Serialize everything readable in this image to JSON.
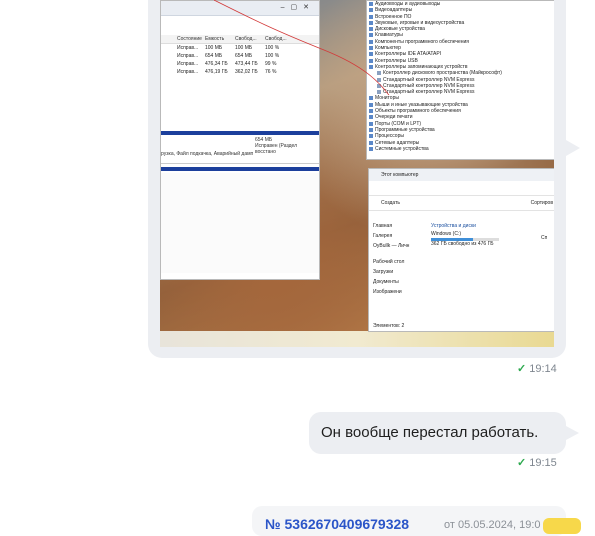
{
  "messages": [
    {
      "type": "image",
      "time": "19:14",
      "screenshot": {
        "disk_management": {
          "columns": [
            "",
            "Состояние",
            "Емкость",
            "Свобод...",
            "Свобод..."
          ],
          "rows": [
            [
              "",
              "Исправ...",
              "100 МБ",
              "100 МБ",
              "100 %"
            ],
            [
              "",
              "Исправ...",
              "654 МБ",
              "654 МБ",
              "100 %"
            ],
            [
              "",
              "Исправ...",
              "476,34 ГБ",
              "473,44 ГБ",
              "99 %"
            ],
            [
              "",
              "Исправ...",
              "476,19 ГБ",
              "362,02 ГБ",
              "76 %"
            ]
          ],
          "disk_text": "рузка, Файл подкачка, Аварийный дамп пам",
          "disk_info_size": "654 МБ",
          "disk_info_status": "Исправен (Раздел восстано"
        },
        "device_manager": {
          "items": [
            {
              "label": "Аудиовходы и аудиовыходы",
              "sub": false
            },
            {
              "label": "Видеоадаптеры",
              "sub": false
            },
            {
              "label": "Встроенное ПО",
              "sub": false
            },
            {
              "label": "Звуковые, игровые и видеоустройства",
              "sub": false
            },
            {
              "label": "Дисковые устройства",
              "sub": false
            },
            {
              "label": "Клавиатуры",
              "sub": false
            },
            {
              "label": "Компоненты программного обеспечения",
              "sub": false
            },
            {
              "label": "Компьютер",
              "sub": false
            },
            {
              "label": "Контроллеры IDE ATA/ATAPI",
              "sub": false
            },
            {
              "label": "Контроллеры USB",
              "sub": false
            },
            {
              "label": "Контроллеры запоминающих устройств",
              "sub": false
            },
            {
              "label": "Контроллер дискового пространства (Майкрософт)",
              "sub": true
            },
            {
              "label": "Стандартный контроллер NVM Express",
              "sub": true
            },
            {
              "label": "Стандартный контроллер NVM Express",
              "sub": true
            },
            {
              "label": "Стандартный контроллер NVM Express",
              "sub": true
            },
            {
              "label": "Мониторы",
              "sub": false
            },
            {
              "label": "Мыши и иные указывающие устройства",
              "sub": false
            },
            {
              "label": "Объекты программного обеспечения",
              "sub": false
            },
            {
              "label": "Очереди печати",
              "sub": false
            },
            {
              "label": "Порты (COM и LPT)",
              "sub": false
            },
            {
              "label": "Программные устройства",
              "sub": false
            },
            {
              "label": "Процессоры",
              "sub": false
            },
            {
              "label": "Сетевые адаптеры",
              "sub": false
            },
            {
              "label": "Системные устройства",
              "sub": false
            }
          ]
        },
        "explorer": {
          "title": "Этот компьютер",
          "create_label": "Создать",
          "sort_label": "Сортиров",
          "sidebar": [
            "Главная",
            "Галерея",
            "OyBullk — Личн",
            "Рабочий стол",
            "Загрузки",
            "Документы",
            "Изображени"
          ],
          "section_title": "Устройства и диски",
          "drive_name": "Windows (C:)",
          "drive_free": "362 ГБ свободно из 476 ГБ",
          "second_drive": "Сп",
          "status": "Элементов: 2"
        }
      }
    },
    {
      "type": "text",
      "text": "Он вообще перестал работать.",
      "time": "19:15"
    }
  ],
  "ticket": {
    "link": "№ 5362670409679328",
    "date": "от 05.05.2024, 19:0"
  },
  "colors": {
    "bubble": "#eceef2",
    "check": "#2da94f",
    "link": "#2b55c8",
    "badge": "#f7d84a"
  }
}
